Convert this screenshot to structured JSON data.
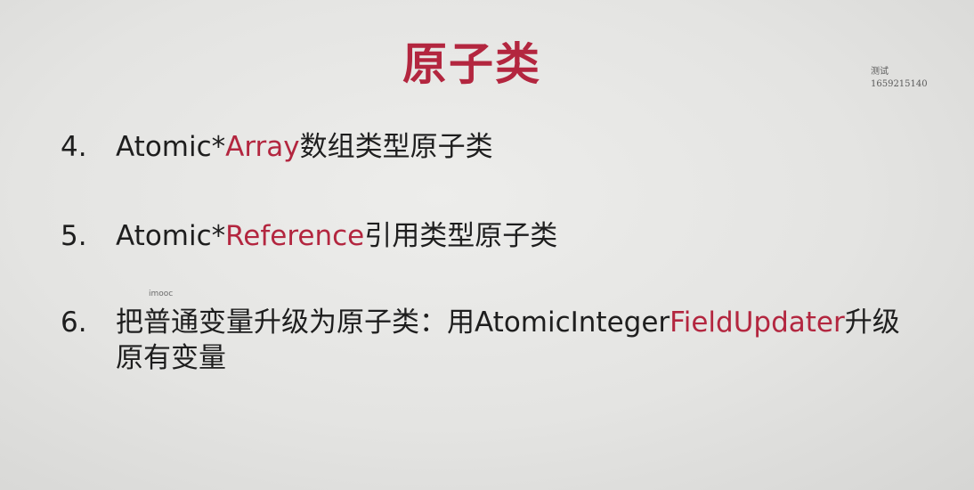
{
  "title": "原子类",
  "watermark": {
    "line1": "测试",
    "line2": "1659215140"
  },
  "mark": "imooc",
  "items": [
    {
      "number": "4.",
      "prefix": "Atomic*",
      "highlight": "Array",
      "suffix": "数组类型原子类"
    },
    {
      "number": "5.",
      "prefix": "Atomic*",
      "highlight": "Reference",
      "suffix": "引用类型原子类"
    },
    {
      "number": "6.",
      "prefix": "把普通变量升级为原子类：用AtomicInteger",
      "highlight": "FieldUpdater",
      "suffix": "升级",
      "line2": "原有变量"
    }
  ],
  "colors": {
    "accent": "#b3263f",
    "text": "#1e1e1e",
    "background": "#e6e6e4"
  }
}
